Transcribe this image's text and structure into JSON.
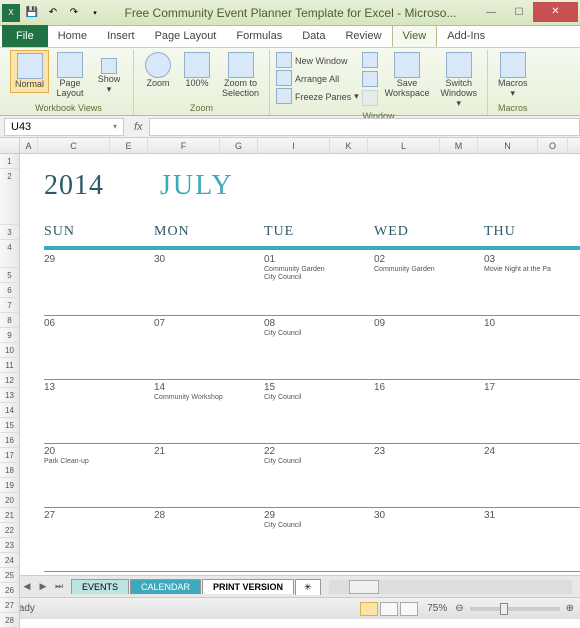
{
  "title": "Free Community Event Planner Template for Excel  -  Microso...",
  "tabs": {
    "file": "File",
    "list": [
      "Home",
      "Insert",
      "Page Layout",
      "Formulas",
      "Data",
      "Review",
      "View",
      "Add-Ins"
    ],
    "active": "View"
  },
  "ribbon": {
    "wbviews": {
      "normal": "Normal",
      "pagelayout": "Page\nLayout",
      "show": "Show",
      "label": "Workbook Views"
    },
    "zoomg": {
      "zoom": "Zoom",
      "hundred": "100%",
      "tosel": "Zoom to\nSelection",
      "label": "Zoom"
    },
    "window": {
      "newwin": "New Window",
      "arrange": "Arrange All",
      "freeze": "Freeze Panes",
      "save": "Save\nWorkspace",
      "switch": "Switch\nWindows",
      "label": "Window"
    },
    "macros": {
      "btn": "Macros",
      "label": "Macros"
    }
  },
  "namebox": "U43",
  "fx": "fx",
  "cols": [
    "A",
    "C",
    "E",
    "F",
    "G",
    "I",
    "K",
    "L",
    "M",
    "N",
    "O"
  ],
  "rows": [
    "1",
    "2",
    "3",
    "4",
    "5",
    "6",
    "7",
    "8",
    "9",
    "10",
    "11",
    "12",
    "13",
    "14",
    "15",
    "16",
    "17",
    "18",
    "19",
    "20",
    "21",
    "22",
    "23",
    "24",
    "25",
    "26",
    "27",
    "28"
  ],
  "calendar": {
    "year": "2014",
    "month": "JULY",
    "days": [
      "SUN",
      "MON",
      "TUE",
      "WED",
      "THU"
    ],
    "weeks": [
      [
        {
          "n": "29",
          "ev": []
        },
        {
          "n": "30",
          "ev": []
        },
        {
          "n": "01",
          "ev": [
            "Community Garden",
            "City Council"
          ]
        },
        {
          "n": "02",
          "ev": [
            "Community Garden"
          ]
        },
        {
          "n": "03",
          "ev": [
            "Movie Night at the Pa"
          ]
        }
      ],
      [
        {
          "n": "06",
          "ev": []
        },
        {
          "n": "07",
          "ev": []
        },
        {
          "n": "08",
          "ev": [
            "City Council"
          ]
        },
        {
          "n": "09",
          "ev": []
        },
        {
          "n": "10",
          "ev": []
        }
      ],
      [
        {
          "n": "13",
          "ev": []
        },
        {
          "n": "14",
          "ev": [
            "Community Workshop"
          ]
        },
        {
          "n": "15",
          "ev": [
            "City Council"
          ]
        },
        {
          "n": "16",
          "ev": []
        },
        {
          "n": "17",
          "ev": []
        }
      ],
      [
        {
          "n": "20",
          "ev": [
            "Park Clean-up"
          ]
        },
        {
          "n": "21",
          "ev": []
        },
        {
          "n": "22",
          "ev": [
            "City Council"
          ]
        },
        {
          "n": "23",
          "ev": []
        },
        {
          "n": "24",
          "ev": []
        }
      ],
      [
        {
          "n": "27",
          "ev": []
        },
        {
          "n": "28",
          "ev": []
        },
        {
          "n": "29",
          "ev": [
            "City Council"
          ]
        },
        {
          "n": "30",
          "ev": []
        },
        {
          "n": "31",
          "ev": []
        }
      ]
    ]
  },
  "sheets": {
    "events": "EVENTS",
    "calendar": "CALENDAR",
    "print": "PRINT VERSION"
  },
  "status": {
    "ready": "Ready",
    "zoom": "75%"
  }
}
